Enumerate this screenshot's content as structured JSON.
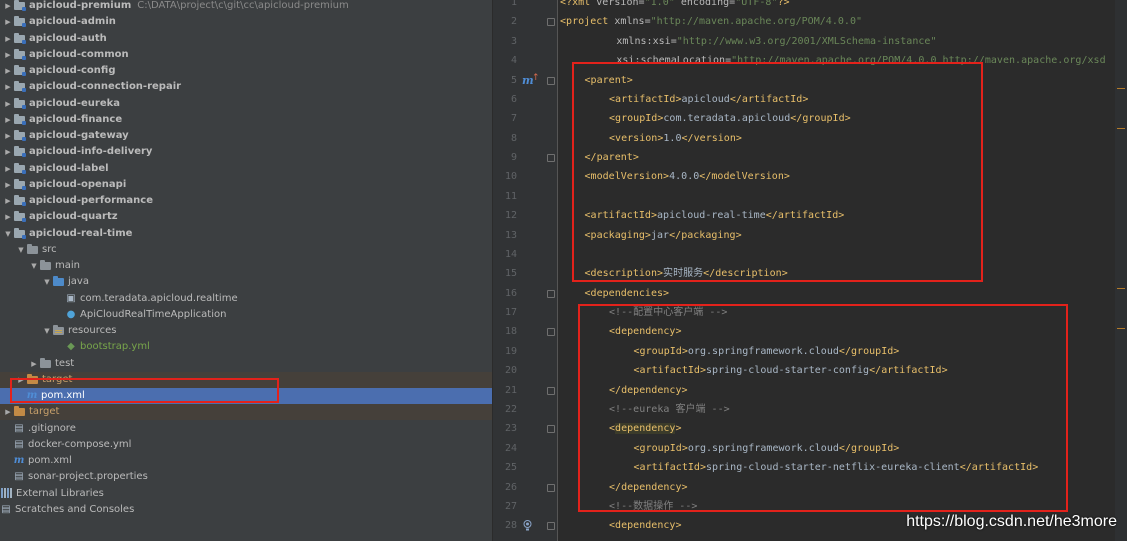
{
  "project_tree": {
    "rows": [
      {
        "indent": 0,
        "arrow": "right",
        "icon": "module",
        "label": "apicloud-premium",
        "path": "C:\\DATA\\project\\c\\git\\cc\\apicloud-premium",
        "bold": true
      },
      {
        "indent": 0,
        "arrow": "right",
        "icon": "module",
        "label": "apicloud-admin",
        "bold": true
      },
      {
        "indent": 0,
        "arrow": "right",
        "icon": "module",
        "label": "apicloud-auth",
        "bold": true
      },
      {
        "indent": 0,
        "arrow": "right",
        "icon": "module",
        "label": "apicloud-common",
        "bold": true
      },
      {
        "indent": 0,
        "arrow": "right",
        "icon": "module",
        "label": "apicloud-config",
        "bold": true
      },
      {
        "indent": 0,
        "arrow": "right",
        "icon": "module",
        "label": "apicloud-connection-repair",
        "bold": true
      },
      {
        "indent": 0,
        "arrow": "right",
        "icon": "module",
        "label": "apicloud-eureka",
        "bold": true
      },
      {
        "indent": 0,
        "arrow": "right",
        "icon": "module",
        "label": "apicloud-finance",
        "bold": true
      },
      {
        "indent": 0,
        "arrow": "right",
        "icon": "module",
        "label": "apicloud-gateway",
        "bold": true
      },
      {
        "indent": 0,
        "arrow": "right",
        "icon": "module",
        "label": "apicloud-info-delivery",
        "bold": true
      },
      {
        "indent": 0,
        "arrow": "right",
        "icon": "module",
        "label": "apicloud-label",
        "bold": true
      },
      {
        "indent": 0,
        "arrow": "right",
        "icon": "module",
        "label": "apicloud-openapi",
        "bold": true
      },
      {
        "indent": 0,
        "arrow": "right",
        "icon": "module",
        "label": "apicloud-performance",
        "bold": true
      },
      {
        "indent": 0,
        "arrow": "right",
        "icon": "module",
        "label": "apicloud-quartz",
        "bold": true
      },
      {
        "indent": 0,
        "arrow": "down",
        "icon": "module",
        "label": "apicloud-real-time",
        "bold": true
      },
      {
        "indent": 1,
        "arrow": "down",
        "icon": "gray",
        "label": "src"
      },
      {
        "indent": 2,
        "arrow": "down",
        "icon": "gray",
        "label": "main"
      },
      {
        "indent": 3,
        "arrow": "down",
        "icon": "blue",
        "label": "java"
      },
      {
        "indent": 4,
        "arrow": "none",
        "icon": "pkg",
        "label": "com.teradata.apicloud.realtime"
      },
      {
        "indent": 4,
        "arrow": "none",
        "icon": "cls",
        "label": "ApiCloudRealTimeApplication"
      },
      {
        "indent": 3,
        "arrow": "down",
        "icon": "res",
        "label": "resources"
      },
      {
        "indent": 4,
        "arrow": "none",
        "icon": "yml",
        "label": "bootstrap.yml",
        "color": "green"
      },
      {
        "indent": 2,
        "arrow": "right",
        "icon": "gray",
        "label": "test"
      },
      {
        "indent": 1,
        "arrow": "right",
        "icon": "orange",
        "label": "target",
        "excluded": true
      },
      {
        "indent": 1,
        "arrow": "none",
        "icon": "mvn",
        "label": "pom.xml",
        "selected": true
      },
      {
        "indent": 0,
        "arrow": "right",
        "icon": "orange",
        "label": "target",
        "excluded": true
      },
      {
        "indent": 0,
        "arrow": "none",
        "icon": "file",
        "label": ".gitignore"
      },
      {
        "indent": 0,
        "arrow": "none",
        "icon": "file",
        "label": "docker-compose.yml"
      },
      {
        "indent": 0,
        "arrow": "none",
        "icon": "mvn",
        "label": "pom.xml"
      },
      {
        "indent": 0,
        "arrow": "none",
        "icon": "file",
        "label": "sonar-project.properties"
      },
      {
        "indent": -1,
        "arrow": "none",
        "icon": "lib",
        "label": "External Libraries"
      },
      {
        "indent": -1,
        "arrow": "none",
        "icon": "file",
        "label": "Scratches and Consoles"
      }
    ]
  },
  "editor": {
    "lines": [
      {
        "n": "1",
        "depth": 0,
        "segs": [
          [
            "tag",
            "<?"
          ],
          [
            "tn",
            "xml "
          ],
          [
            "attr",
            "version="
          ],
          [
            "str",
            "\"1.0\" "
          ],
          [
            "attr",
            "encoding="
          ],
          [
            "str",
            "\"UTF-8\""
          ],
          [
            "tag",
            "?>"
          ]
        ]
      },
      {
        "n": "2",
        "depth": 0,
        "segs": [
          [
            "tag",
            "<"
          ],
          [
            "tn",
            "project "
          ],
          [
            "attr",
            "xmlns="
          ],
          [
            "str",
            "\"http://maven.apache.org/POM/4.0.0\""
          ]
        ]
      },
      {
        "n": "3",
        "depth": 2.3,
        "segs": [
          [
            "attr",
            "xmlns:xsi="
          ],
          [
            "str",
            "\"http://www.w3.org/2001/XMLSchema-instance\""
          ]
        ]
      },
      {
        "n": "4",
        "depth": 2.3,
        "segs": [
          [
            "attr",
            "xsi:schemaLocation="
          ],
          [
            "str",
            "\"http://maven.apache.org/POM/4.0.0 http://maven.apache.org/xsd"
          ]
        ]
      },
      {
        "n": "5",
        "depth": 1,
        "segs": [
          [
            "tag",
            "<"
          ],
          [
            "tn",
            "parent"
          ],
          [
            "tag",
            ">"
          ]
        ]
      },
      {
        "n": "6",
        "depth": 2,
        "segs": [
          [
            "tag",
            "<"
          ],
          [
            "tn",
            "artifactId"
          ],
          [
            "tag",
            ">"
          ],
          [
            "val",
            "apicloud"
          ],
          [
            "tag",
            "</"
          ],
          [
            "tn",
            "artifactId"
          ],
          [
            "tag",
            ">"
          ]
        ]
      },
      {
        "n": "7",
        "depth": 2,
        "segs": [
          [
            "tag",
            "<"
          ],
          [
            "tn",
            "groupId"
          ],
          [
            "tag",
            ">"
          ],
          [
            "val",
            "com.teradata.apicloud"
          ],
          [
            "tag",
            "</"
          ],
          [
            "tn",
            "groupId"
          ],
          [
            "tag",
            ">"
          ]
        ]
      },
      {
        "n": "8",
        "depth": 2,
        "segs": [
          [
            "tag",
            "<"
          ],
          [
            "tn",
            "version"
          ],
          [
            "tag",
            ">"
          ],
          [
            "val",
            "1.0"
          ],
          [
            "tag",
            "</"
          ],
          [
            "tn",
            "version"
          ],
          [
            "tag",
            ">"
          ]
        ]
      },
      {
        "n": "9",
        "depth": 1,
        "segs": [
          [
            "tag",
            "</"
          ],
          [
            "tn",
            "parent"
          ],
          [
            "tag",
            ">"
          ]
        ]
      },
      {
        "n": "10",
        "depth": 1,
        "segs": [
          [
            "tag",
            "<"
          ],
          [
            "tn",
            "modelVersion"
          ],
          [
            "tag",
            ">"
          ],
          [
            "val",
            "4.0.0"
          ],
          [
            "tag",
            "</"
          ],
          [
            "tn",
            "modelVersion"
          ],
          [
            "tag",
            ">"
          ]
        ]
      },
      {
        "n": "11",
        "depth": 0,
        "segs": []
      },
      {
        "n": "12",
        "depth": 1,
        "segs": [
          [
            "tag",
            "<"
          ],
          [
            "tn",
            "artifactId"
          ],
          [
            "tag",
            ">"
          ],
          [
            "val",
            "apicloud-real-time"
          ],
          [
            "tag",
            "</"
          ],
          [
            "tn",
            "artifactId"
          ],
          [
            "tag",
            ">"
          ]
        ]
      },
      {
        "n": "13",
        "depth": 1,
        "segs": [
          [
            "tag",
            "<"
          ],
          [
            "tn",
            "packaging"
          ],
          [
            "tag",
            ">"
          ],
          [
            "val",
            "jar"
          ],
          [
            "tag",
            "</"
          ],
          [
            "tn",
            "packaging"
          ],
          [
            "tag",
            ">"
          ]
        ]
      },
      {
        "n": "14",
        "depth": 0,
        "segs": []
      },
      {
        "n": "15",
        "depth": 1,
        "segs": [
          [
            "tag",
            "<"
          ],
          [
            "tn",
            "description"
          ],
          [
            "tag",
            ">"
          ],
          [
            "val",
            "实时服务"
          ],
          [
            "tag",
            "</"
          ],
          [
            "tn",
            "description"
          ],
          [
            "tag",
            ">"
          ]
        ]
      },
      {
        "n": "16",
        "depth": 1,
        "segs": [
          [
            "tag",
            "<"
          ],
          [
            "tn",
            "dependencies"
          ],
          [
            "tag",
            ">"
          ]
        ]
      },
      {
        "n": "17",
        "depth": 2,
        "segs": [
          [
            "cm",
            "<!--配置中心客户端 -->"
          ]
        ]
      },
      {
        "n": "18",
        "depth": 2,
        "segs": [
          [
            "tag",
            "<"
          ],
          [
            "tn",
            "dependency"
          ],
          [
            "tag",
            ">"
          ]
        ]
      },
      {
        "n": "19",
        "depth": 3,
        "segs": [
          [
            "tag",
            "<"
          ],
          [
            "tn",
            "groupId"
          ],
          [
            "tag",
            ">"
          ],
          [
            "val",
            "org.springframework.cloud"
          ],
          [
            "tag",
            "</"
          ],
          [
            "tn",
            "groupId"
          ],
          [
            "tag",
            ">"
          ]
        ]
      },
      {
        "n": "20",
        "depth": 3,
        "segs": [
          [
            "tag",
            "<"
          ],
          [
            "tn",
            "artifactId"
          ],
          [
            "tag",
            ">"
          ],
          [
            "val",
            "spring-cloud-starter-config"
          ],
          [
            "tag",
            "</"
          ],
          [
            "tn",
            "artifactId"
          ],
          [
            "tag",
            ">"
          ]
        ]
      },
      {
        "n": "21",
        "depth": 2,
        "segs": [
          [
            "tag",
            "</"
          ],
          [
            "tn",
            "dependency"
          ],
          [
            "tag",
            ">"
          ]
        ]
      },
      {
        "n": "22",
        "depth": 2,
        "segs": [
          [
            "cm",
            "<!--eureka 客户端 -->"
          ]
        ]
      },
      {
        "n": "23",
        "depth": 2,
        "segs": [
          [
            "tag",
            "<"
          ],
          [
            "hl",
            "dependency"
          ],
          [
            "tag",
            ">"
          ]
        ]
      },
      {
        "n": "24",
        "depth": 3,
        "segs": [
          [
            "tag",
            "<"
          ],
          [
            "tn",
            "groupId"
          ],
          [
            "tag",
            ">"
          ],
          [
            "val",
            "org.springframework.cloud"
          ],
          [
            "tag",
            "</"
          ],
          [
            "tn",
            "groupId"
          ],
          [
            "tag",
            ">"
          ]
        ]
      },
      {
        "n": "25",
        "depth": 3,
        "segs": [
          [
            "tag",
            "<"
          ],
          [
            "tn",
            "artifactId"
          ],
          [
            "tag",
            ">"
          ],
          [
            "val",
            "spring-cloud-starter-netflix-eureka-client"
          ],
          [
            "tag",
            "</"
          ],
          [
            "tn",
            "artifactId"
          ],
          [
            "tag",
            ">"
          ]
        ]
      },
      {
        "n": "26",
        "depth": 2,
        "segs": [
          [
            "tag",
            "</"
          ],
          [
            "tn",
            "dependency"
          ],
          [
            "tag",
            ">"
          ]
        ]
      },
      {
        "n": "27",
        "depth": 2,
        "segs": [
          [
            "cm",
            "<!--数据操作 -->"
          ]
        ]
      },
      {
        "n": "28",
        "depth": 2,
        "segs": [
          [
            "tag",
            "<"
          ],
          [
            "tn",
            "dependency"
          ],
          [
            "tag",
            ">"
          ]
        ]
      }
    ],
    "fold_markers": [
      2,
      5,
      9,
      16,
      18,
      21,
      23,
      26,
      28
    ]
  },
  "watermark": "https://blog.csdn.net/he3more",
  "colors": {
    "annotation_red": "#e3221b",
    "selection": "#4b6eaf",
    "xml_tag": "#e8bf6a",
    "xml_string": "#6a8759",
    "comment": "#808080"
  }
}
